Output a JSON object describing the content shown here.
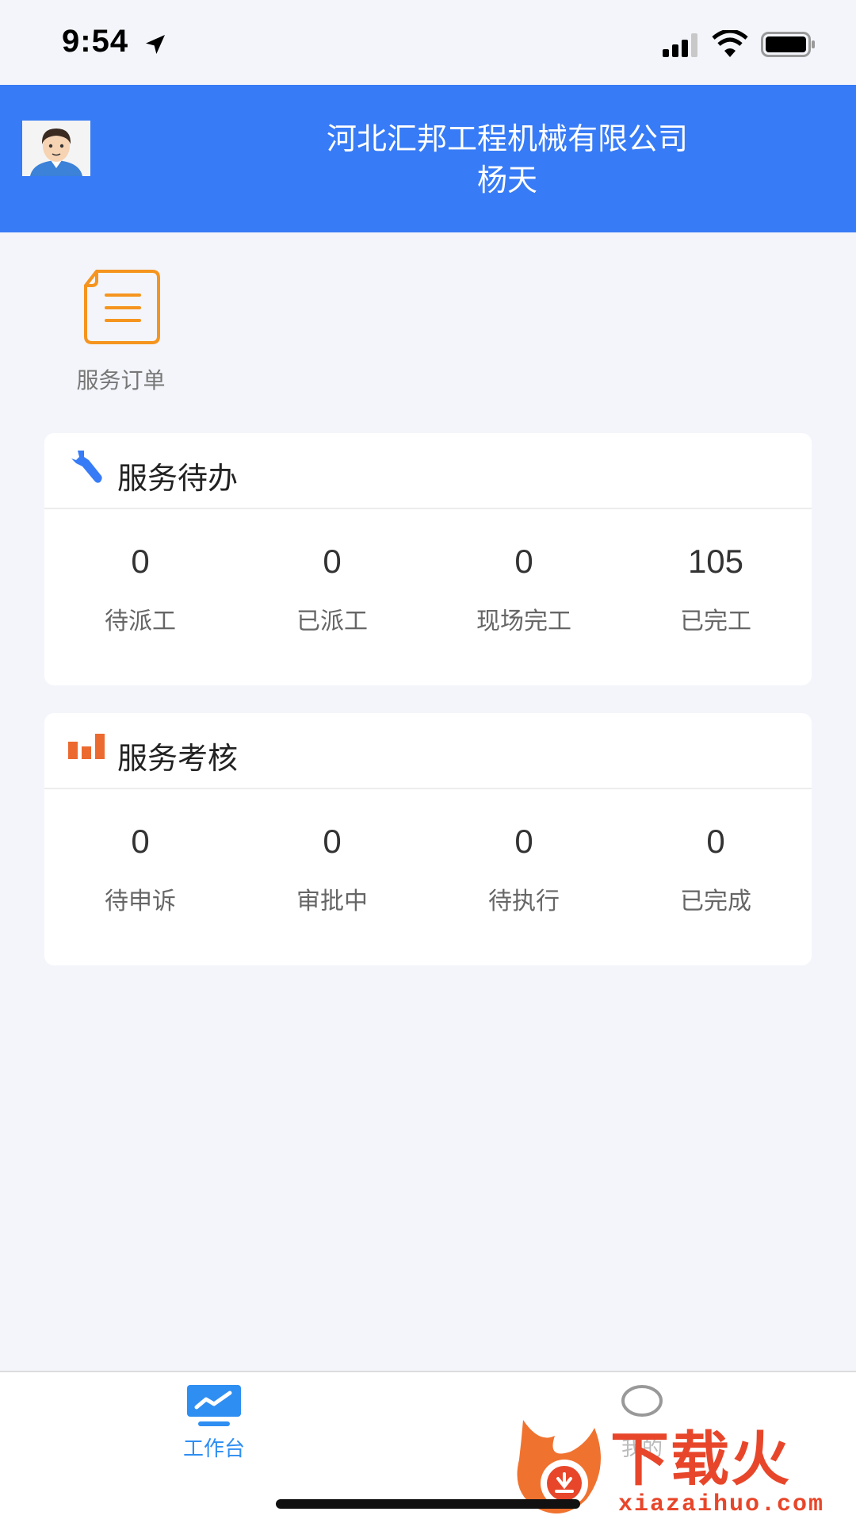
{
  "status_bar": {
    "time": "9:54",
    "icons": [
      "location-arrow-icon",
      "signal-icon",
      "wifi-icon",
      "battery-icon"
    ]
  },
  "header": {
    "company": "河北汇邦工程机械有限公司",
    "user_name": "杨天",
    "background_color": "#377bf6"
  },
  "quick_entry": {
    "label": "服务订单",
    "icon": "document-icon",
    "icon_color": "#f5951f"
  },
  "service_todo": {
    "title": "服务待办",
    "icon": "wrench-icon",
    "icon_color": "#377bf6",
    "items": [
      {
        "value": "0",
        "label": "待派工"
      },
      {
        "value": "0",
        "label": "已派工"
      },
      {
        "value": "0",
        "label": "现场完工"
      },
      {
        "value": "105",
        "label": "已完工"
      }
    ]
  },
  "service_assessment": {
    "title": "服务考核",
    "icon": "bar-chart-icon",
    "icon_color": "#ec6a2f",
    "items": [
      {
        "value": "0",
        "label": "待申诉"
      },
      {
        "value": "0",
        "label": "审批中"
      },
      {
        "value": "0",
        "label": "待执行"
      },
      {
        "value": "0",
        "label": "已完成"
      }
    ]
  },
  "tabbar": {
    "tabs": [
      {
        "label": "工作台",
        "icon": "workbench-icon",
        "active": true
      },
      {
        "label": "我的",
        "icon": "person-icon",
        "active": false
      }
    ],
    "active_color": "#2e8ef2"
  },
  "watermark": {
    "cn": "下载火",
    "en": "xiazaihuo.com"
  }
}
